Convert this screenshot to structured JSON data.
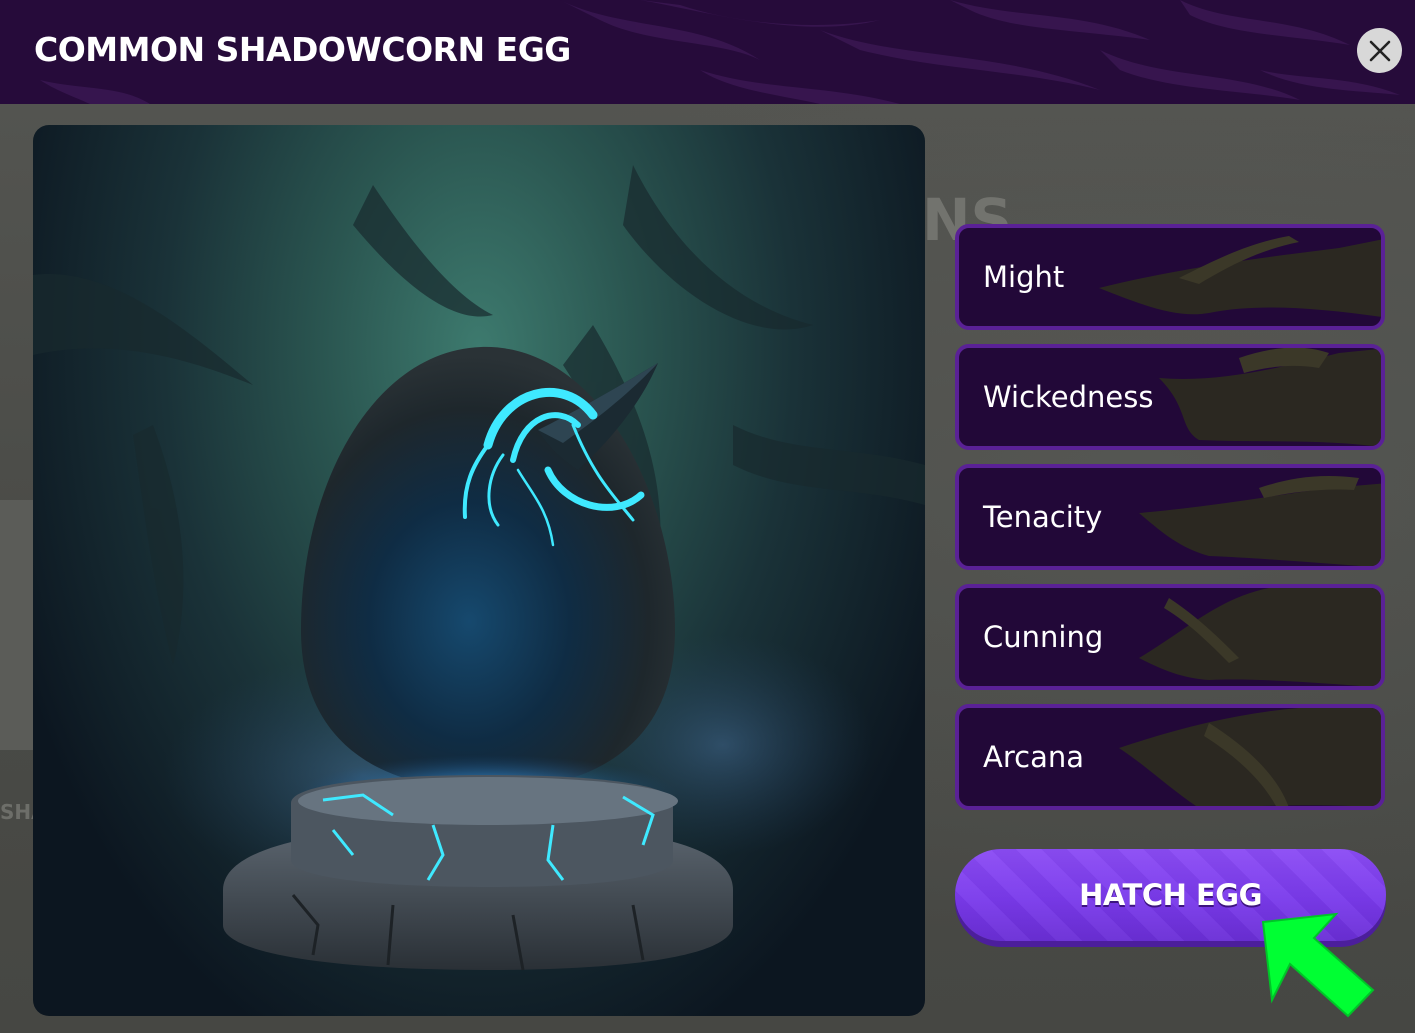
{
  "dialog": {
    "title": "COMMON SHADOWCORN EGG",
    "close_icon": "close-icon"
  },
  "background": {
    "ghost_text_right": "NS",
    "ghost_text_left": "SHA"
  },
  "egg_image": {
    "description_icon": "shadowcorn-egg-image"
  },
  "stats": [
    {
      "label": "Might"
    },
    {
      "label": "Wickedness"
    },
    {
      "label": "Tenacity"
    },
    {
      "label": "Cunning"
    },
    {
      "label": "Arcana"
    }
  ],
  "actions": {
    "hatch_label": "HATCH EGG"
  },
  "colors": {
    "header_bg": "#260b3a",
    "stat_bg": "#220838",
    "stat_border": "#5a2196",
    "button_purple": "#7a3aeb",
    "arrow_green": "#00ff33",
    "glow_cyan": "#3fe9ff"
  }
}
